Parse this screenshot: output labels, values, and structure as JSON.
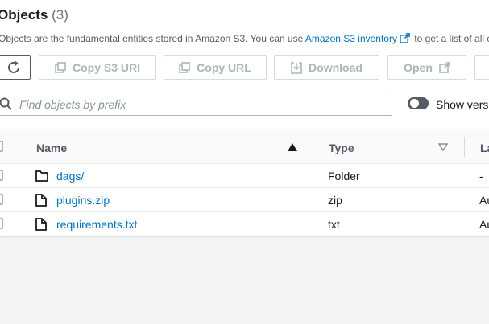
{
  "header": {
    "title": "Objects",
    "count": "(3)",
    "description_prefix": "Objects are the fundamental entities stored in Amazon S3. You can use ",
    "inventory_link": "Amazon S3 inventory",
    "description_suffix": " to get a list of all objects in your bucket."
  },
  "toolbar": {
    "copy_s3_uri": "Copy S3 URI",
    "copy_url": "Copy URL",
    "download": "Download",
    "open": "Open"
  },
  "search": {
    "placeholder": "Find objects by prefix"
  },
  "toggle": {
    "label": "Show versions"
  },
  "table": {
    "columns": [
      "Name",
      "Type",
      "Last modified"
    ],
    "rows": [
      {
        "name": "dags/",
        "icon": "folder-icon",
        "type": "Folder",
        "last": "-"
      },
      {
        "name": "plugins.zip",
        "icon": "file-icon",
        "type": "zip",
        "last": "Aug"
      },
      {
        "name": "requirements.txt",
        "icon": "file-icon",
        "type": "txt",
        "last": "Aug"
      }
    ]
  },
  "colors": {
    "link": "#0073bb",
    "text": "#16191f",
    "muted": "#545b64",
    "disabled": "#aab7b8",
    "border": "#d5dbdb"
  }
}
